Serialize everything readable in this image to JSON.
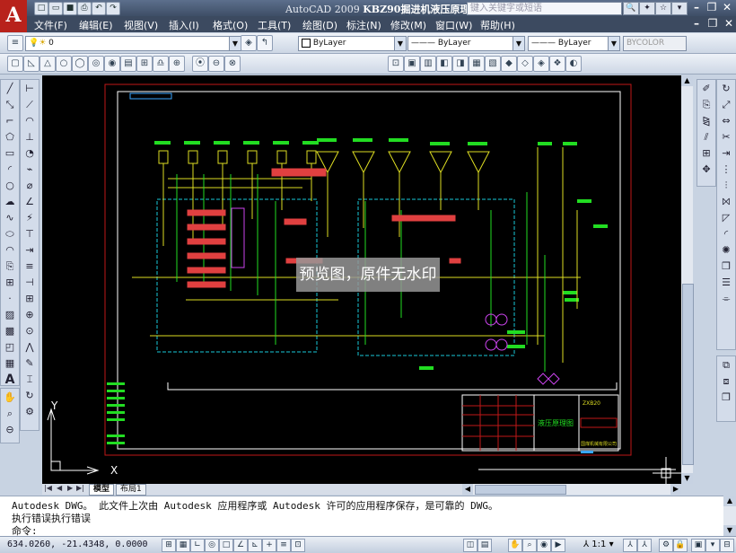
{
  "app": {
    "logo": "A",
    "title_prefix": "AutoCAD 2009",
    "title_doc": "KBZ90掘进机液压原理图",
    "search_placeholder": "键入关键字或短语"
  },
  "menu": [
    "文件(F)",
    "编辑(E)",
    "视图(V)",
    "插入(I)",
    "格式(O)",
    "工具(T)",
    "绘图(D)",
    "标注(N)",
    "修改(M)",
    "窗口(W)",
    "帮助(H)"
  ],
  "toolbar": {
    "layer_value": "0",
    "color_value": "ByLayer",
    "linetype_value": "ByLayer",
    "lineweight_value": "ByLayer",
    "plotstyle_value": "BYCOLOR"
  },
  "drawing": {
    "frame_label": "液压原理图",
    "company": "国煤机械有限公司",
    "drawing_no": "ZXB20",
    "ucs_x": "X",
    "ucs_y": "Y",
    "watermark": "预览图，原件无水印"
  },
  "tabs": {
    "model": "模型",
    "layout1": "布局1"
  },
  "command": {
    "line1": "Autodesk DWG。  此文件上次由 Autodesk 应用程序或 Autodesk 许可的应用程序保存，是可靠的 DWG。",
    "line2": "执行错误执行错误",
    "prompt": "命令:"
  },
  "status": {
    "coords": "634.0260, -21.4348, 0.0000",
    "scale": "1:1"
  }
}
